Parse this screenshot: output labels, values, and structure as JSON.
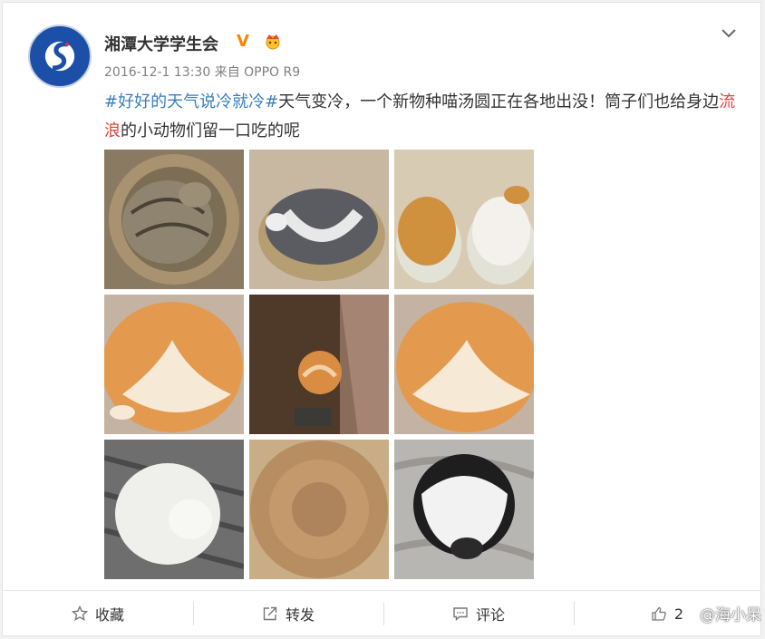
{
  "post": {
    "author": "湘潭大学学生会",
    "meta": "2016-12-1 13:30 来自 OPPO R9",
    "text": {
      "hashtag": "#好好的天气说冷就冷#",
      "part1": "天气变冷，一个新物种喵汤圆正在各地出没！筒子们也给身边",
      "keyword": "流浪",
      "part2": "的小动物们留一口吃的呢"
    },
    "photos": [
      {
        "name": "photo-1"
      },
      {
        "name": "photo-2"
      },
      {
        "name": "photo-3"
      },
      {
        "name": "photo-4"
      },
      {
        "name": "photo-5"
      },
      {
        "name": "photo-6"
      },
      {
        "name": "photo-7"
      },
      {
        "name": "photo-8"
      },
      {
        "name": "photo-9"
      }
    ]
  },
  "actions": {
    "favorite": "收藏",
    "repost": "转发",
    "comment": "评论",
    "like_count": "2"
  },
  "watermark": "@海小呆",
  "icons": {
    "verified": "V",
    "crown": "crown-icon",
    "favorite": "star-icon",
    "repost": "share-icon",
    "comment": "comment-icon",
    "like": "thumb-up-icon",
    "expand": "chevron-down-icon"
  },
  "colors": {
    "accent": "#3a7ebf",
    "keyword": "#e0453a",
    "verified": "#ff8200"
  }
}
